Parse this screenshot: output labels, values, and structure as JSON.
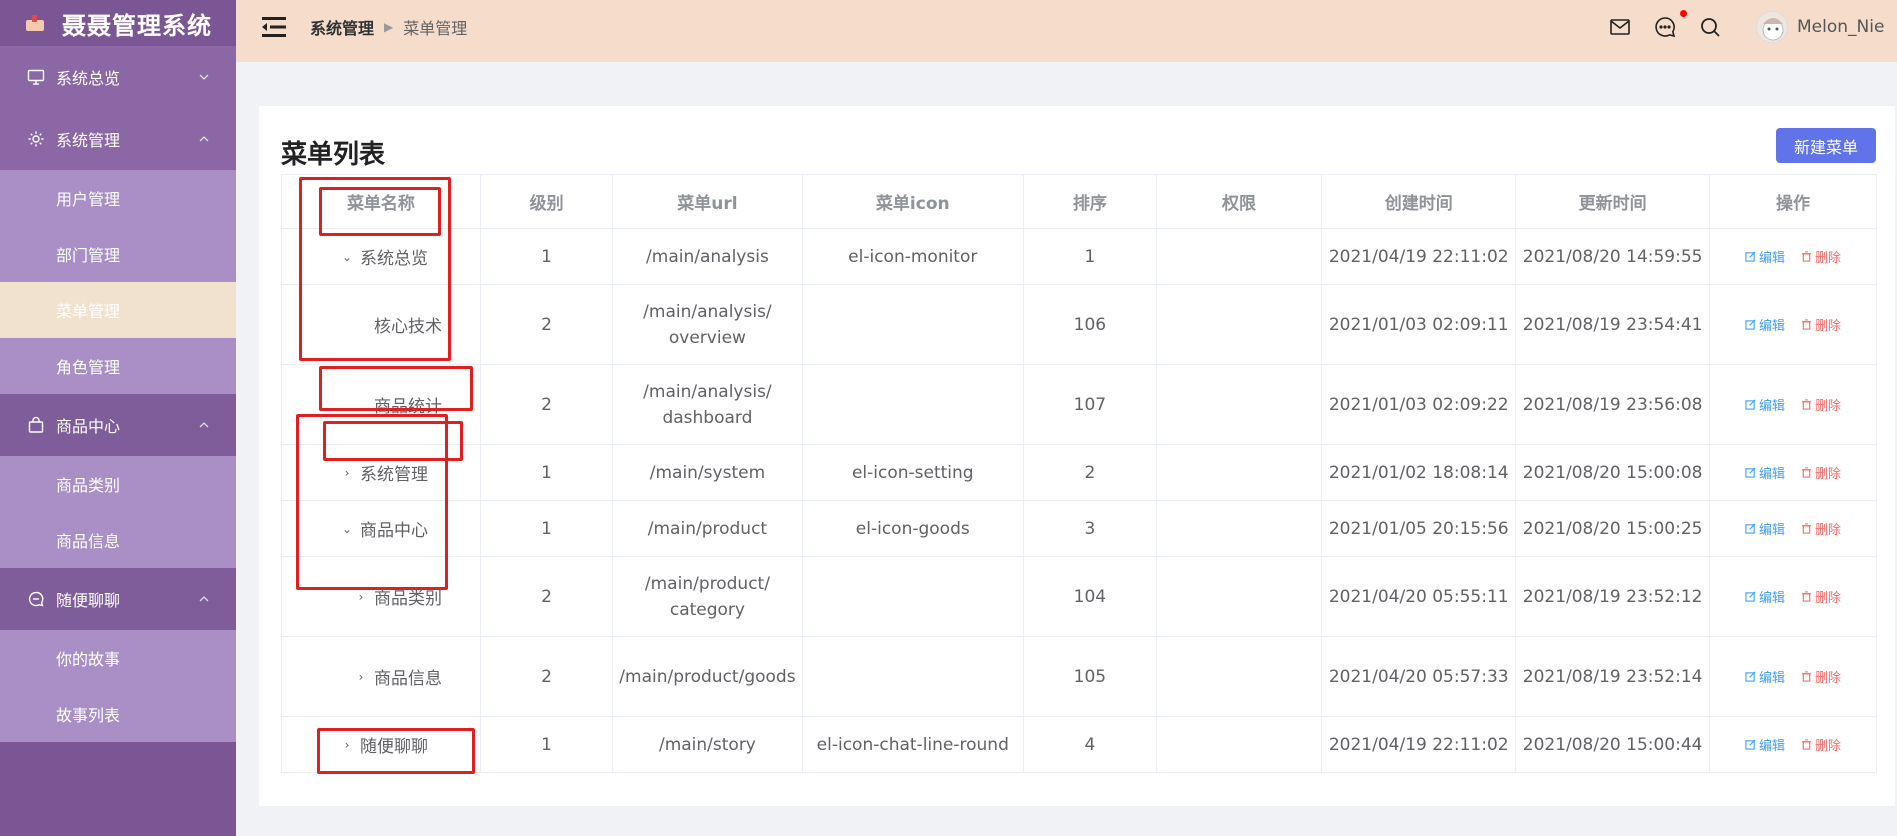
{
  "app": {
    "logo_text": "聂聂管理系统"
  },
  "sidebar": {
    "groups": [
      {
        "label": "系统总览",
        "icon": "monitor-icon",
        "expanded": false,
        "items": []
      },
      {
        "label": "系统管理",
        "icon": "gear-icon",
        "expanded": true,
        "items": [
          {
            "label": "用户管理",
            "active": false
          },
          {
            "label": "部门管理",
            "active": false
          },
          {
            "label": "菜单管理",
            "active": true
          },
          {
            "label": "角色管理",
            "active": false
          }
        ]
      },
      {
        "label": "商品中心",
        "icon": "bag-icon",
        "expanded": true,
        "items": [
          {
            "label": "商品类别",
            "active": false
          },
          {
            "label": "商品信息",
            "active": false
          }
        ]
      },
      {
        "label": "随便聊聊",
        "icon": "chat-icon",
        "expanded": true,
        "items": [
          {
            "label": "你的故事",
            "active": false
          },
          {
            "label": "故事列表",
            "active": false
          }
        ]
      }
    ]
  },
  "header": {
    "breadcrumb": [
      "系统管理",
      "菜单管理"
    ],
    "username": "Melon_Nie"
  },
  "main": {
    "title": "菜单列表",
    "new_button": "新建菜单",
    "columns": [
      "菜单名称",
      "级别",
      "菜单url",
      "菜单icon",
      "排序",
      "权限",
      "创建时间",
      "更新时间",
      "操作"
    ],
    "edit_label": "编辑",
    "delete_label": "删除",
    "rows": [
      {
        "name": "系统总览",
        "indent": 0,
        "arrow": "down",
        "level": "1",
        "url": "/main/analysis",
        "icon": "el-icon-monitor",
        "sort": "1",
        "perm": "",
        "created": "2021/04/19 22:11:02",
        "updated": "2021/08/20 14:59:55"
      },
      {
        "name": "核心技术",
        "indent": 1,
        "arrow": "none",
        "level": "2",
        "url": "/main/analysis/overview",
        "icon": "",
        "sort": "106",
        "perm": "",
        "created": "2021/01/03 02:09:11",
        "updated": "2021/08/19 23:54:41"
      },
      {
        "name": "商品统计",
        "indent": 1,
        "arrow": "none",
        "level": "2",
        "url": "/main/analysis/dashboard",
        "icon": "",
        "sort": "107",
        "perm": "",
        "created": "2021/01/03 02:09:22",
        "updated": "2021/08/19 23:56:08"
      },
      {
        "name": "系统管理",
        "indent": 0,
        "arrow": "right",
        "level": "1",
        "url": "/main/system",
        "icon": "el-icon-setting",
        "sort": "2",
        "perm": "",
        "created": "2021/01/02 18:08:14",
        "updated": "2021/08/20 15:00:08"
      },
      {
        "name": "商品中心",
        "indent": 0,
        "arrow": "down",
        "level": "1",
        "url": "/main/product",
        "icon": "el-icon-goods",
        "sort": "3",
        "perm": "",
        "created": "2021/01/05 20:15:56",
        "updated": "2021/08/20 15:00:25"
      },
      {
        "name": "商品类别",
        "indent": 1,
        "arrow": "right",
        "level": "2",
        "url": "/main/product/category",
        "icon": "",
        "sort": "104",
        "perm": "",
        "created": "2021/04/20 05:55:11",
        "updated": "2021/08/19 23:52:12"
      },
      {
        "name": "商品信息",
        "indent": 1,
        "arrow": "right",
        "level": "2",
        "url": "/main/product/goods",
        "icon": "",
        "sort": "105",
        "perm": "",
        "created": "2021/04/20 05:57:33",
        "updated": "2021/08/19 23:52:14"
      },
      {
        "name": "随便聊聊",
        "indent": 0,
        "arrow": "right",
        "level": "1",
        "url": "/main/story",
        "icon": "el-icon-chat-line-round",
        "sort": "4",
        "perm": "",
        "created": "2021/04/19 22:11:02",
        "updated": "2021/08/20 15:00:44"
      }
    ]
  },
  "colors": {
    "sidebar": "#7a5794",
    "sidebar_sub": "#a98fc5",
    "header": "#f6dccb",
    "primary_button": "#6173e8",
    "edit": "#409eff",
    "delete": "#f56c6c",
    "highlight_box": "#e02020"
  }
}
